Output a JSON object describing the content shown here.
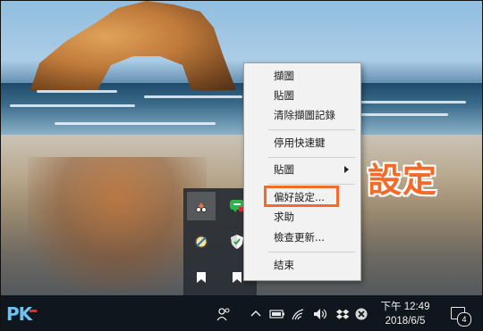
{
  "context_menu": {
    "items": [
      {
        "label": "擷圖"
      },
      {
        "label": "貼圖"
      },
      {
        "label": "清除擷圖記錄"
      },
      {
        "label": "停用快速鍵"
      },
      {
        "label": "貼圖",
        "has_submenu": true
      },
      {
        "label": "偏好設定...",
        "highlighted": true
      },
      {
        "label": "求助"
      },
      {
        "label": "檢查更新..."
      },
      {
        "label": "結束"
      }
    ]
  },
  "annotation": {
    "text": "設定",
    "color": "#f26b2a"
  },
  "taskbar": {
    "logo_text": "PK",
    "clock_time": "下午 12:49",
    "clock_date": "2018/6/5",
    "notification_count": "4"
  },
  "tray_icons": [
    "snipaste-icon",
    "line-chat-icon",
    "screenshot-tool-icon",
    "defender-shield-icon",
    "bookmark-icon",
    "bookmark-icon"
  ],
  "taskbar_icons": [
    "people-icon",
    "chevron-up-icon",
    "battery-icon",
    "wifi-icon",
    "volume-icon",
    "dropbox-icon",
    "close-circle-icon",
    "action-center-icon"
  ]
}
